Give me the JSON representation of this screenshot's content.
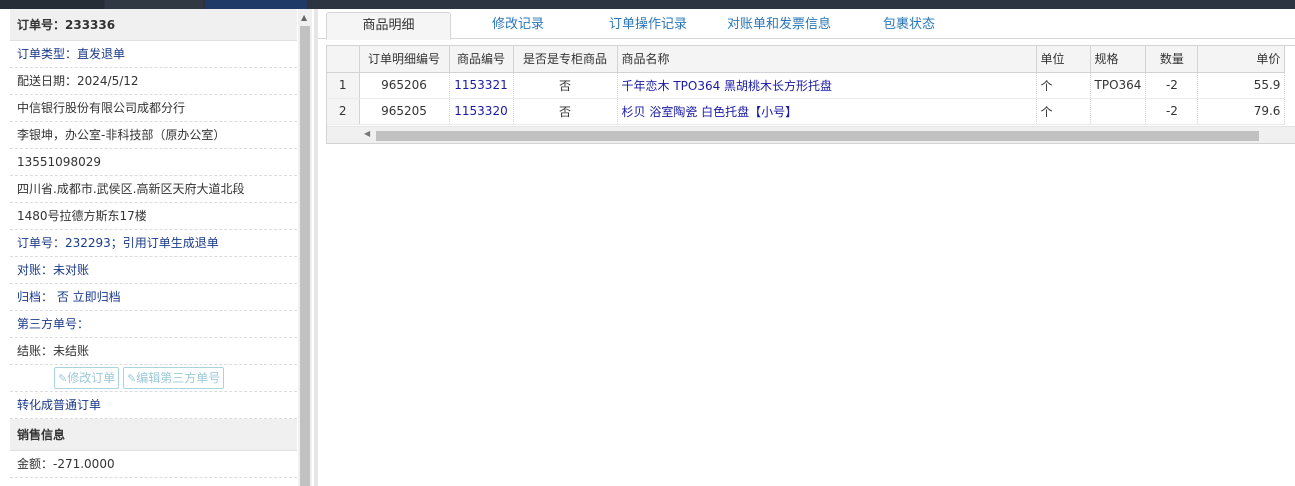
{
  "order": {
    "header": "订单号：233336",
    "type": "订单类型：直发退单",
    "delivery_date": "配送日期：2024/5/12",
    "company": "中信银行股份有限公司成都分行",
    "contact": "李银坤，办公室-非科技部（原办公室）",
    "phone": "13551098029",
    "address_line1": "四川省.成都市.武侯区.高新区天府大道北段",
    "address_line2": "1480号拉德方斯东17楼",
    "ref_order": "订单号：232293；引用订单生成退单",
    "reconcile": "对账：未对账",
    "archive": "归档：  否 立即归档",
    "third_party": "第三方单号：",
    "settle": "结账：未结账",
    "btn_edit_order": "修改订单",
    "btn_edit_third": "编辑第三方单号",
    "convert": "转化成普通订单",
    "sales_section": "销售信息",
    "amount": "金额：-271.0000"
  },
  "tabs": [
    {
      "label": "商品明细"
    },
    {
      "label": "修改记录"
    },
    {
      "label": "订单操作记录"
    },
    {
      "label": "对账单和发票信息"
    },
    {
      "label": "包裹状态"
    }
  ],
  "grid": {
    "columns": [
      "",
      "订单明细编号",
      "商品编号",
      "是否是专柜商品",
      "商品名称",
      "单位",
      "规格",
      "数量",
      "单价"
    ],
    "rows": [
      {
        "n": "1",
        "detail_id": "965206",
        "product_id": "1153321",
        "counter": "否",
        "name": "千年恋木 TPO364 黑胡桃木长方形托盘",
        "unit": "个",
        "spec": "TPO364",
        "qty": "-2",
        "price": "55.9"
      },
      {
        "n": "2",
        "detail_id": "965205",
        "product_id": "1153320",
        "counter": "否",
        "name": "杉贝 浴室陶瓷 白色托盘【小号】",
        "unit": "个",
        "spec": "",
        "qty": "-2",
        "price": "79.6"
      }
    ]
  },
  "icons": {
    "pencil": "edit-icon",
    "scroll_up": "scroll-up-arrow-icon",
    "scroll_left": "scroll-left-arrow-icon"
  }
}
